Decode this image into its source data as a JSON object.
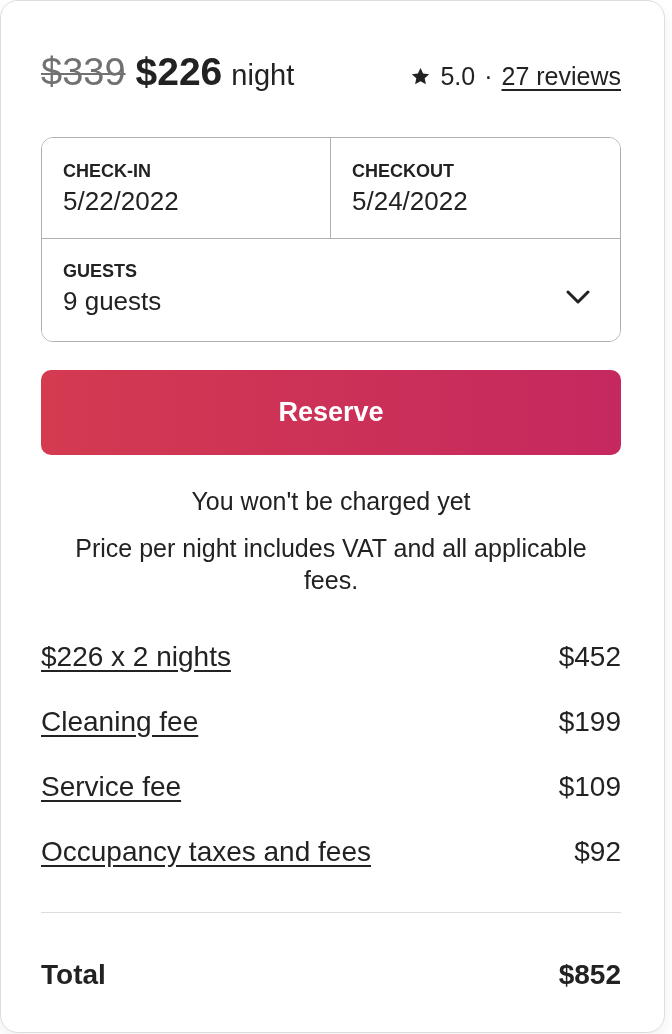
{
  "price": {
    "original": "$339",
    "current": "$226",
    "unit": "night"
  },
  "rating": {
    "score": "5.0",
    "separator": "·",
    "reviews": "27 reviews"
  },
  "booking": {
    "check_in": {
      "label": "CHECK-IN",
      "value": "5/22/2022"
    },
    "checkout": {
      "label": "CHECKOUT",
      "value": "5/24/2022"
    },
    "guests": {
      "label": "GUESTS",
      "value": "9 guests"
    }
  },
  "reserve_button": "Reserve",
  "notes": [
    "You won't be charged yet",
    "Price per night includes VAT and all applicable fees."
  ],
  "fees": [
    {
      "label": "$226 x 2 nights",
      "amount": "$452"
    },
    {
      "label": "Cleaning fee",
      "amount": "$199"
    },
    {
      "label": "Service fee",
      "amount": "$109"
    },
    {
      "label": "Occupancy taxes and fees",
      "amount": "$92"
    }
  ],
  "total": {
    "label": "Total",
    "amount": "$852"
  }
}
